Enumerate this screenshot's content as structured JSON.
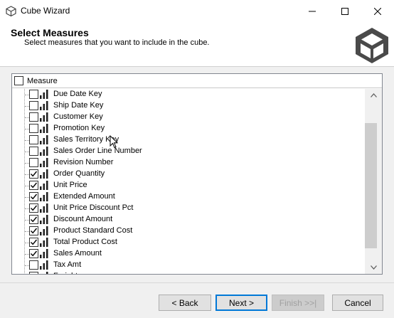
{
  "window": {
    "title": "Cube Wizard"
  },
  "header": {
    "title": "Select Measures",
    "subtitle": "Select measures that you want to include in the cube."
  },
  "list": {
    "column_header": "Measure",
    "header_checked": false,
    "items": [
      {
        "label": "Due Date Key",
        "checked": false
      },
      {
        "label": "Ship Date Key",
        "checked": false
      },
      {
        "label": "Customer Key",
        "checked": false
      },
      {
        "label": "Promotion Key",
        "checked": false
      },
      {
        "label": "Sales Territory Key",
        "checked": false
      },
      {
        "label": "Sales Order Line Number",
        "checked": false
      },
      {
        "label": "Revision Number",
        "checked": false
      },
      {
        "label": "Order Quantity",
        "checked": true
      },
      {
        "label": "Unit Price",
        "checked": true
      },
      {
        "label": "Extended Amount",
        "checked": true
      },
      {
        "label": "Unit Price Discount Pct",
        "checked": true
      },
      {
        "label": "Discount Amount",
        "checked": true
      },
      {
        "label": "Product Standard Cost",
        "checked": true
      },
      {
        "label": "Total Product Cost",
        "checked": true
      },
      {
        "label": "Sales Amount",
        "checked": true
      },
      {
        "label": "Tax Amt",
        "checked": false
      },
      {
        "label": "Freight",
        "checked": false
      }
    ]
  },
  "buttons": {
    "back": "< Back",
    "next": "Next >",
    "finish": "Finish >>|",
    "cancel": "Cancel"
  },
  "colors": {
    "accent": "#0078d7",
    "measure_icon": "#1e1e1e"
  }
}
